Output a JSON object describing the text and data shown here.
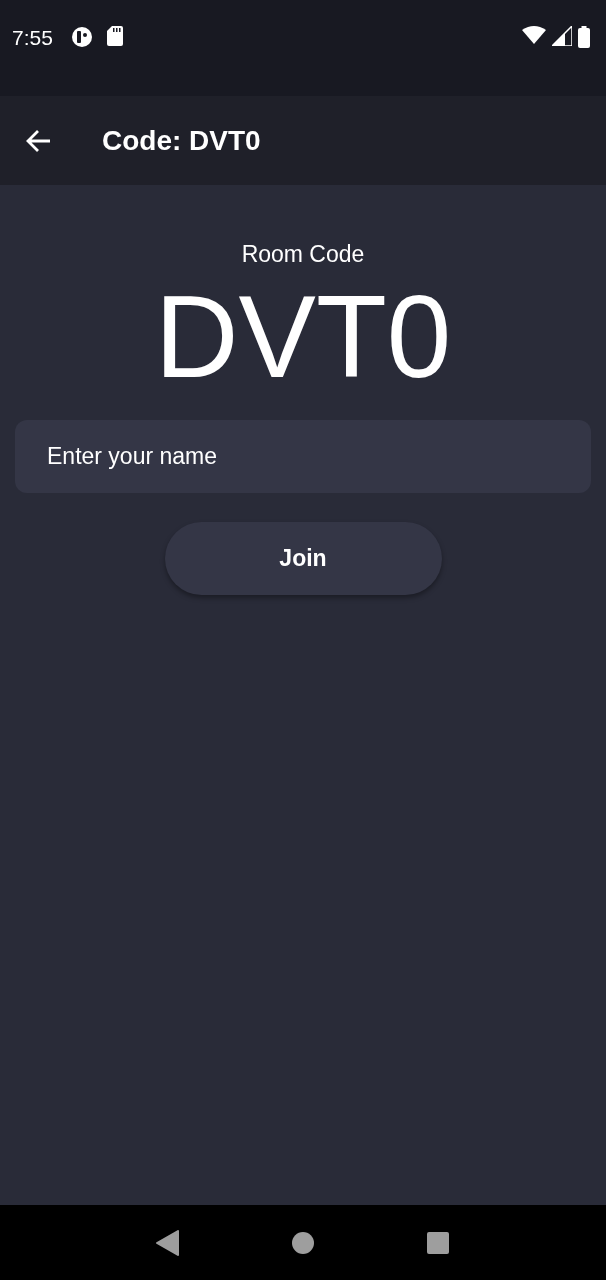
{
  "status_bar": {
    "time": "7:55"
  },
  "app_bar": {
    "title": "Code: DVT0"
  },
  "room": {
    "label": "Room Code",
    "code": "DVT0"
  },
  "name_field": {
    "placeholder": "Enter your name"
  },
  "join_button": {
    "label": "Join"
  }
}
